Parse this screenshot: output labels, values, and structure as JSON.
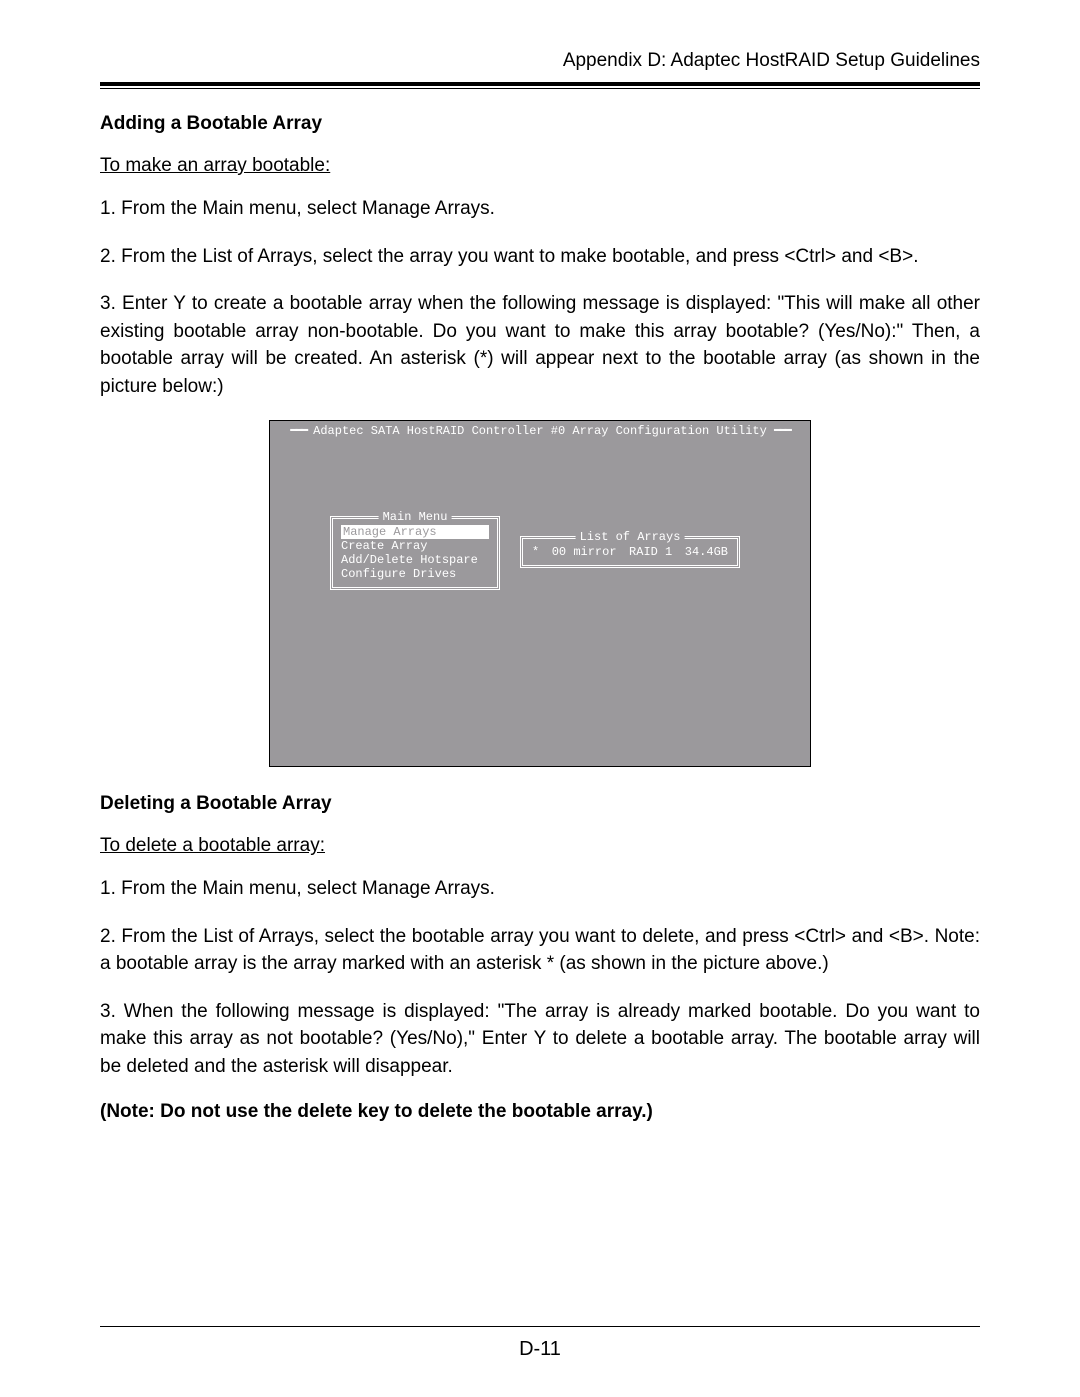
{
  "header": {
    "running": "Appendix D: Adaptec HostRAID Setup Guidelines"
  },
  "adding": {
    "title": "Adding a Bootable Array",
    "sub": "To make an array bootable:",
    "p1": "1. From the Main menu, select Manage Arrays.",
    "p2": "2. From the List of Arrays, select the array you want to make bootable, and press <Ctrl> and <B>.",
    "p3": "3. Enter Y to create a bootable array when the following message is displayed: \"This will make all other existing bootable array non-bootable. Do you want to make this array bootable? (Yes/No):\" Then, a bootable array will be created.  An asterisk (*) will appear next to the bootable array (as shown in the picture below:)"
  },
  "bios": {
    "title": "Adaptec SATA HostRAID Controller #0 Array Configuration Utility",
    "main_menu": {
      "legend": "Main Menu",
      "items": [
        "Manage Arrays",
        "Create Array",
        "Add/Delete Hotspare",
        "Configure Drives"
      ]
    },
    "arrays": {
      "legend": "List of Arrays",
      "row": {
        "mark": "*",
        "name": "00 mirror",
        "type": "RAID 1",
        "size": "34.4GB"
      }
    }
  },
  "deleting": {
    "title": "Deleting a Bootable Array",
    "sub": "To delete a bootable array:",
    "p1": "1. From the Main menu, select Manage Arrays.",
    "p2": "2. From the List of Arrays, select the bootable array you want to delete, and press <Ctrl> and <B>. Note: a bootable array is the array marked with an asterisk * (as shown in the picture above.)",
    "p3": "3. When the following message is displayed: \"The array is already marked bootable. Do you want to make this array as not bootable? (Yes/No),\" Enter Y to delete a bootable array.  The bootable array will be deleted and the asterisk will disappear.",
    "note": "(Note: Do not use the delete key to delete the bootable array.)"
  },
  "page_number": "D-11"
}
